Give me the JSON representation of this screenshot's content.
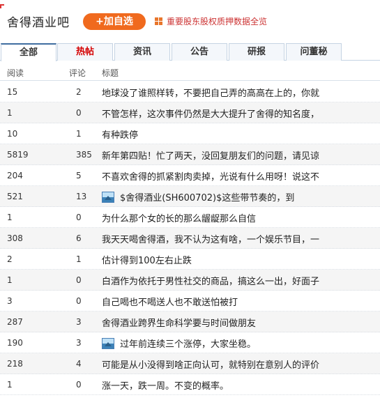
{
  "header": {
    "title": "舍得酒业吧",
    "follow_label": "+加自选",
    "news_link": "重要股东股权质押数据全览"
  },
  "tabs": [
    {
      "label": "全部",
      "active": true
    },
    {
      "label": "热帖",
      "hot": true
    },
    {
      "label": "资讯"
    },
    {
      "label": "公告"
    },
    {
      "label": "研报"
    },
    {
      "label": "问董秘"
    }
  ],
  "columns": {
    "reads": "阅读",
    "comments": "评论",
    "title": "标题"
  },
  "posts": [
    {
      "reads": "15",
      "comments": "2",
      "title": "地球没了谁照样转，不要把自己弄的高高在上的，你就",
      "image": false
    },
    {
      "reads": "1",
      "comments": "0",
      "title": "不管怎样，这次事件仍然是大大提升了舍得的知名度，",
      "image": false
    },
    {
      "reads": "10",
      "comments": "1",
      "title": "有种跌停",
      "image": false
    },
    {
      "reads": "5819",
      "comments": "385",
      "title": "新年第四贴！忙了两天，没回复朋友们的问题，请见谅",
      "image": false
    },
    {
      "reads": "204",
      "comments": "5",
      "title": "不喜欢舍得的抓紧割肉卖掉，光说有什么用呀！说这不",
      "image": false
    },
    {
      "reads": "521",
      "comments": "13",
      "title": "$舍得酒业(SH600702)$这些带节奏的，到",
      "image": true
    },
    {
      "reads": "1",
      "comments": "0",
      "title": "为什么那个女的长的那么龌龊那么自信",
      "image": false
    },
    {
      "reads": "308",
      "comments": "6",
      "title": "我天天喝舍得酒，我不认为这有啥，一个娱乐节目，一",
      "image": false
    },
    {
      "reads": "2",
      "comments": "1",
      "title": "估计得到100左右止跌",
      "image": false
    },
    {
      "reads": "1",
      "comments": "0",
      "title": "白酒作为依托于男性社交的商品，搞这么一出，好面子",
      "image": false
    },
    {
      "reads": "3",
      "comments": "0",
      "title": "自己喝也不喝送人也不敢送怕被打",
      "image": false
    },
    {
      "reads": "287",
      "comments": "3",
      "title": "舍得酒业跨界生命科学要与时间做朋友",
      "image": false
    },
    {
      "reads": "190",
      "comments": "3",
      "title": "过年前连续三个涨停，大家坐稳。",
      "image": true
    },
    {
      "reads": "218",
      "comments": "4",
      "title": "可能是从小没得到啥正向认可，就特别在意别人的评价",
      "image": false
    },
    {
      "reads": "1",
      "comments": "0",
      "title": "涨一天，跌一周。不变的概率。",
      "image": false
    }
  ]
}
